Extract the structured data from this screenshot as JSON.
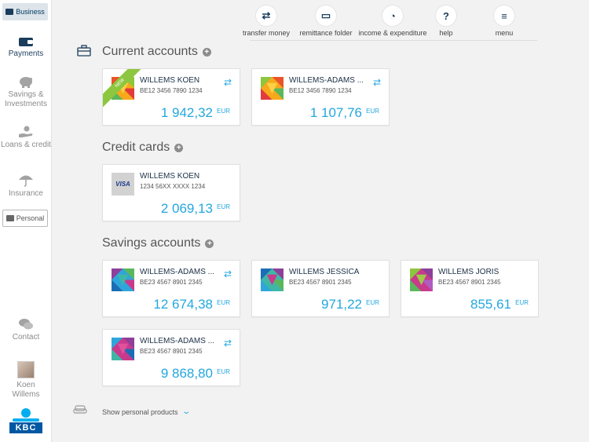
{
  "sidebar": {
    "business_label": "Business",
    "personal_label": "Personal",
    "items": [
      {
        "label": "Payments"
      },
      {
        "label": "Savings & Investments"
      },
      {
        "label": "Loans & credit"
      },
      {
        "label": "Insurance"
      },
      {
        "label": "Contact"
      }
    ],
    "profile": {
      "first_name": "Koen",
      "last_name": "Willems"
    },
    "logo_text": "KBC"
  },
  "toolbar": [
    {
      "label": "transfer money",
      "icon": "transfer-icon",
      "glyph": "⇄"
    },
    {
      "label": "remittance folder",
      "icon": "inbox-icon",
      "glyph": "▭"
    },
    {
      "label": "income & expenditure",
      "icon": "pie-chart-icon",
      "glyph": "◔"
    },
    {
      "label": "help",
      "icon": "help-icon",
      "glyph": "?"
    },
    {
      "label": "menu",
      "icon": "menu-icon",
      "glyph": "≡"
    }
  ],
  "sections": {
    "current": {
      "title": "Current accounts",
      "accounts": [
        {
          "name": "WILLEMS KOEN",
          "iban": "BE12 3456 7890 1234",
          "amount": "1 942,32",
          "currency": "EUR",
          "badge": "NEW"
        },
        {
          "name": "WILLEMS-ADAMS ...",
          "iban": "BE12 3456 7890 1234",
          "amount": "1 107,76",
          "currency": "EUR"
        }
      ]
    },
    "credit": {
      "title": "Credit cards",
      "cards": [
        {
          "name": "WILLEMS KOEN",
          "number": "1234 56XX XXXX 1234",
          "amount": "2 069,13",
          "currency": "EUR",
          "brand": "VISA"
        }
      ]
    },
    "savings": {
      "title": "Savings accounts",
      "accounts": [
        {
          "name": "WILLEMS-ADAMS ...",
          "iban": "BE23 4567 8901 2345",
          "amount": "12 674,38",
          "currency": "EUR"
        },
        {
          "name": "WILLEMS JESSICA",
          "iban": "BE23 4567 8901 2345",
          "amount": "971,22",
          "currency": "EUR"
        },
        {
          "name": "WILLEMS JORIS",
          "iban": "BE23 4567 8901 2345",
          "amount": "855,61",
          "currency": "EUR"
        },
        {
          "name": "WILLEMS-ADAMS ...",
          "iban": "BE23 4567 8901 2345",
          "amount": "9 868,80",
          "currency": "EUR"
        }
      ]
    }
  },
  "footer": {
    "show_personal_label": "Show personal products"
  },
  "colors": {
    "accent": "#24a7de",
    "navy": "#1b3d5c",
    "ribbon": "#8dc63f",
    "background": "#f2f2f2"
  }
}
